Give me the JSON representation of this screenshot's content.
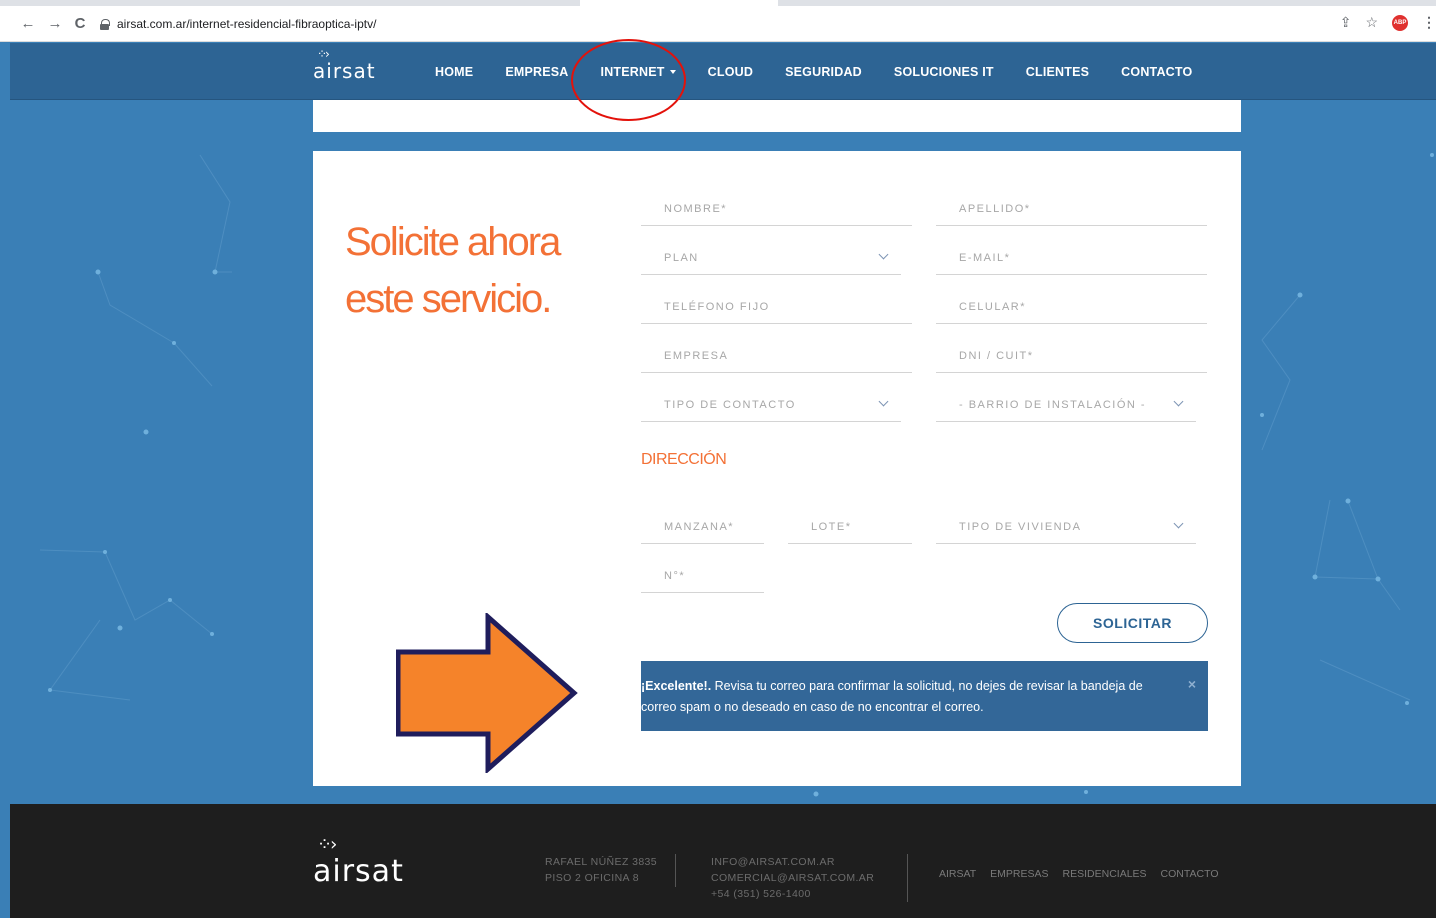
{
  "browser": {
    "url": "airsat.com.ar/internet-residencial-fibraoptica-iptv/",
    "back": "←",
    "forward": "→",
    "reload": "C",
    "abp_label": "ABP"
  },
  "site": {
    "logo": "airsat",
    "menu": [
      "HOME",
      "EMPRESA",
      "INTERNET",
      "CLOUD",
      "SEGURIDAD",
      "SOLUCIONES IT",
      "CLIENTES",
      "CONTACTO"
    ]
  },
  "form": {
    "headline_line1": "Solicite ahora",
    "headline_line2": "este servicio.",
    "nombre": "NOMBRE*",
    "apellido": "APELLIDO*",
    "plan": "PLAN",
    "email": "E-MAIL*",
    "telefono": "TELÉFONO FIJO",
    "celular": "CELULAR*",
    "empresa": "EMPRESA",
    "dni": "DNI / CUIT*",
    "tipo_contacto": "TIPO DE CONTACTO",
    "barrio": "- BARRIO DE INSTALACIÓN -",
    "direccion_label": "DIRECCIÓN",
    "manzana": "MANZANA*",
    "lote": "LOTE*",
    "tipo_vivienda": "TIPO DE VIVIENDA",
    "numero": "N°*",
    "submit": "SOLICITAR"
  },
  "alert": {
    "bold": "¡Excelente!.",
    "message": " Revisa tu correo para confirmar la solicitud, no dejes de revisar la bandeja de correo spam o no deseado en caso de no encontrar el correo.",
    "close": "×"
  },
  "footer": {
    "logo": "airsat",
    "address_line1": "RAFAEL NÚÑEZ 3835",
    "address_line2": "PISO 2 OFICINA 8",
    "email1": "INFO@AIRSAT.COM.AR",
    "email2": "COMERCIAL@AIRSAT.COM.AR",
    "phone": "+54 (351) 526-1400",
    "links": [
      "AIRSAT",
      "EMPRESAS",
      "RESIDENCIALES",
      "CONTACTO"
    ]
  },
  "colors": {
    "nav_bg": "#2d6494",
    "page_bg": "#3a7fb6",
    "accent_orange": "#f37136",
    "alert_bg": "#336798",
    "footer_bg": "#1e1e1e",
    "annotation_red": "#e3120b",
    "annotation_arrow": "#f5832a"
  }
}
